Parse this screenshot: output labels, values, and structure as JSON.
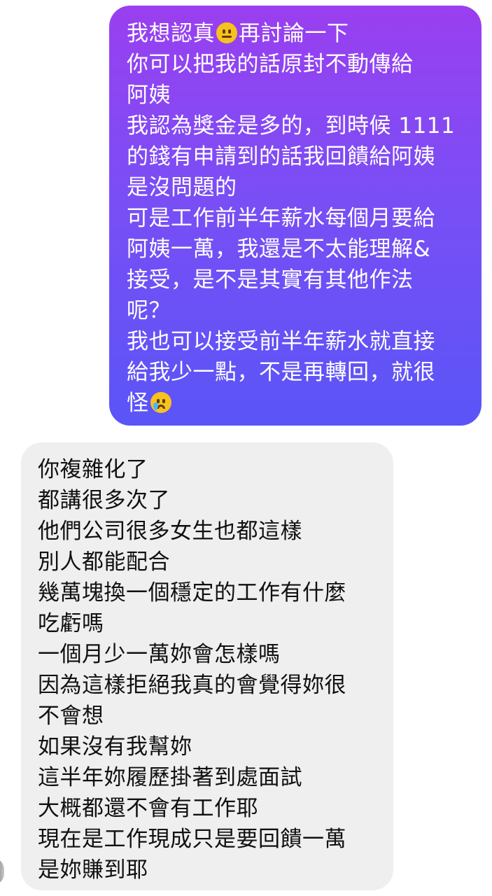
{
  "conversation": {
    "outgoing": {
      "line1_before_emoji": "我想認真",
      "line1_emoji": "neutral-face-emoji",
      "line1_after_emoji": "再討論一下",
      "line2": "你可以把我的話原封不動傳給",
      "line3": "阿姨",
      "line4": "我認為獎金是多的，到時候 1111",
      "line5": "的錢有申請到的話我回饋給阿姨",
      "line6": "是沒問題的",
      "line7": "可是工作前半年薪水每個月要給",
      "line8": "阿姨一萬，我還是不太能理解&",
      "line9": "接受，是不是其實有其他作法",
      "line10": "呢？",
      "line11": "我也可以接受前半年薪水就直接",
      "line12": "給我少一點，不是再轉回，就很",
      "line13_text": "怪",
      "line13_emoji": "crying-face-emoji",
      "bubble_color_top": "#9a3ff0",
      "bubble_color_bottom": "#5a55f7"
    },
    "incoming": {
      "lines": [
        "你複雜化了",
        "都講很多次了",
        "他們公司很多女生也都這樣",
        "別人都能配合",
        "幾萬塊換一個穩定的工作有什麼",
        "吃虧嗎",
        "一個月少一萬妳會怎樣嗎",
        "因為這樣拒絕我真的會覺得妳很",
        "不會想",
        "如果沒有我幫妳",
        "這半年妳履歷掛著到處面試",
        "大概都還不會有工作耶",
        "現在是工作現成只是要回饋一萬",
        "是妳賺到耶"
      ],
      "bubble_color": "#efefef"
    }
  }
}
